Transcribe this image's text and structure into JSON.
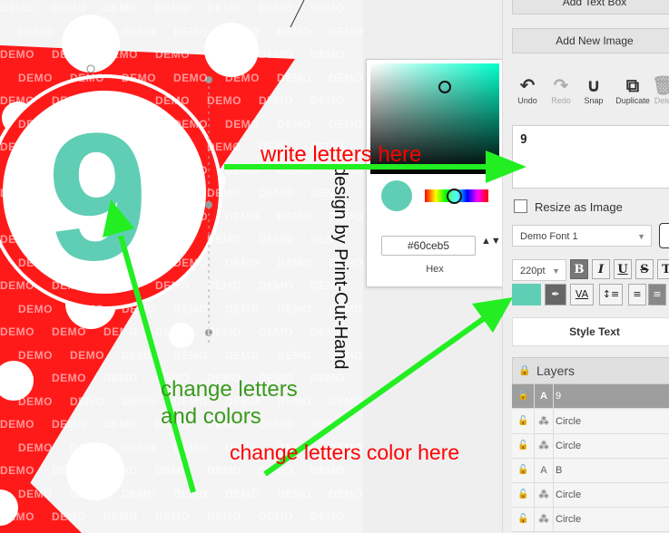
{
  "canvas": {
    "watermark_text": "DEMO",
    "pennant_digit": "9",
    "vertical_credit": "design by Print-Cut-Hand",
    "colors": {
      "red": "#ff1a1a",
      "white": "#ffffff",
      "teal": "#60ceb5"
    }
  },
  "colorpicker": {
    "hex_value": "#60ceb5",
    "hex_label": "Hex",
    "spin_glyph": "▲▼"
  },
  "panel": {
    "add_text_box": "Add Text Box",
    "add_new_image": "Add New Image",
    "tools": [
      {
        "icon": "undo-icon",
        "glyph": "↶",
        "label": "Undo"
      },
      {
        "icon": "redo-icon",
        "glyph": "↷",
        "label": "Redo"
      },
      {
        "icon": "snap-magnet-icon",
        "glyph": "∪",
        "label": "Snap"
      },
      {
        "icon": "duplicate-icon",
        "glyph": "⧉",
        "label": "Duplicate"
      },
      {
        "icon": "delete-icon",
        "glyph": "🗑",
        "label": "Dele"
      }
    ],
    "text_input_value": "9",
    "resize_as_image": "Resize as Image",
    "font_select": "Demo Font 1",
    "size_select": "220pt",
    "format_buttons": [
      "B",
      "I",
      "U",
      "S",
      "T"
    ],
    "fill_color": "#60ceb5",
    "letter_spacing_label": "VA",
    "line_height_glyph": "↕≡",
    "align_left_glyph": "≡",
    "align_center_glyph": "≡",
    "style_text": "Style Text",
    "layers_title": "Layers",
    "layers": [
      {
        "type_glyph": "A",
        "name": "9",
        "selected": true
      },
      {
        "type_glyph": "⁂",
        "name": "Circle",
        "selected": false
      },
      {
        "type_glyph": "⁂",
        "name": "Circle",
        "selected": false
      },
      {
        "type_glyph": "A",
        "name": "B",
        "selected": false
      },
      {
        "type_glyph": "⁂",
        "name": "Circle",
        "selected": false
      },
      {
        "type_glyph": "⁂",
        "name": "Circle",
        "selected": false
      }
    ]
  },
  "annotations": {
    "write_letters": "write letters here",
    "change_letters_and_colors_line1": "change letters",
    "change_letters_and_colors_line2": "and colors",
    "change_color": "change letters color here",
    "colors": {
      "red": "#ff0000",
      "green": "#3a9a1e",
      "arrow": "#22ee22"
    }
  }
}
